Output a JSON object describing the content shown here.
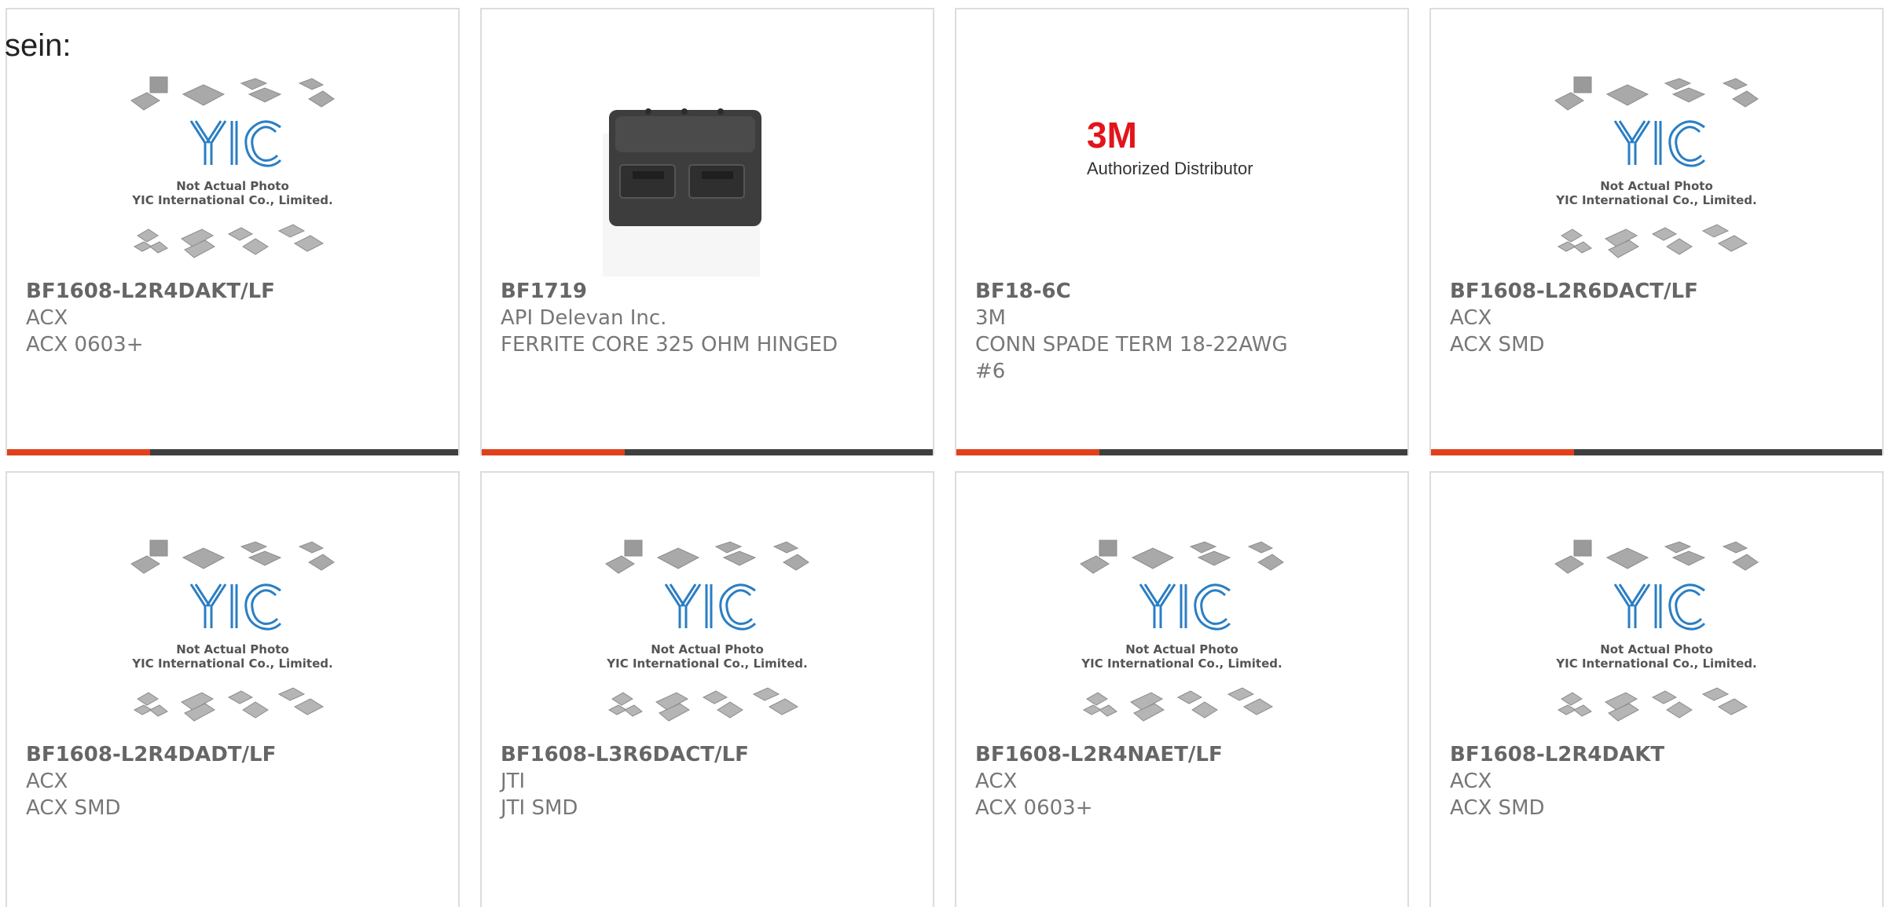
{
  "page": {
    "label": "sein:"
  },
  "colors": {
    "accent": "#e0411c",
    "bar": "#3f3f3f",
    "border": "#dddddd",
    "logo_blue": "#2a7ec4",
    "logo_3m_red": "#e3141b"
  },
  "placeholder": {
    "line1": "Not Actual Photo",
    "line2": "YIC International Co., Limited.",
    "logo": "YIC"
  },
  "products": [
    {
      "part": "BF1608-L2R4DAKT/LF",
      "manufacturer": "ACX",
      "description": "ACX 0603+",
      "image": "placeholder"
    },
    {
      "part": "BF1719",
      "manufacturer": "API Delevan Inc.",
      "description": "FERRITE CORE 325 OHM HINGED",
      "image": "ferrite-core-photo"
    },
    {
      "part": "BF18-6C",
      "manufacturer": "3M",
      "description": "CONN SPADE TERM 18-22AWG #6",
      "image": "3m-logo",
      "logo_text": "3M",
      "logo_sub": "Authorized Distributor"
    },
    {
      "part": "BF1608-L2R6DACT/LF",
      "manufacturer": "ACX",
      "description": "ACX SMD",
      "image": "placeholder"
    },
    {
      "part": "BF1608-L2R4DADT/LF",
      "manufacturer": "ACX",
      "description": "ACX SMD",
      "image": "placeholder"
    },
    {
      "part": "BF1608-L3R6DACT/LF",
      "manufacturer": "JTI",
      "description": "JTI SMD",
      "image": "placeholder"
    },
    {
      "part": "BF1608-L2R4NAET/LF",
      "manufacturer": "ACX",
      "description": "ACX 0603+",
      "image": "placeholder"
    },
    {
      "part": "BF1608-L2R4DAKT",
      "manufacturer": "ACX",
      "description": "ACX SMD",
      "image": "placeholder"
    }
  ]
}
